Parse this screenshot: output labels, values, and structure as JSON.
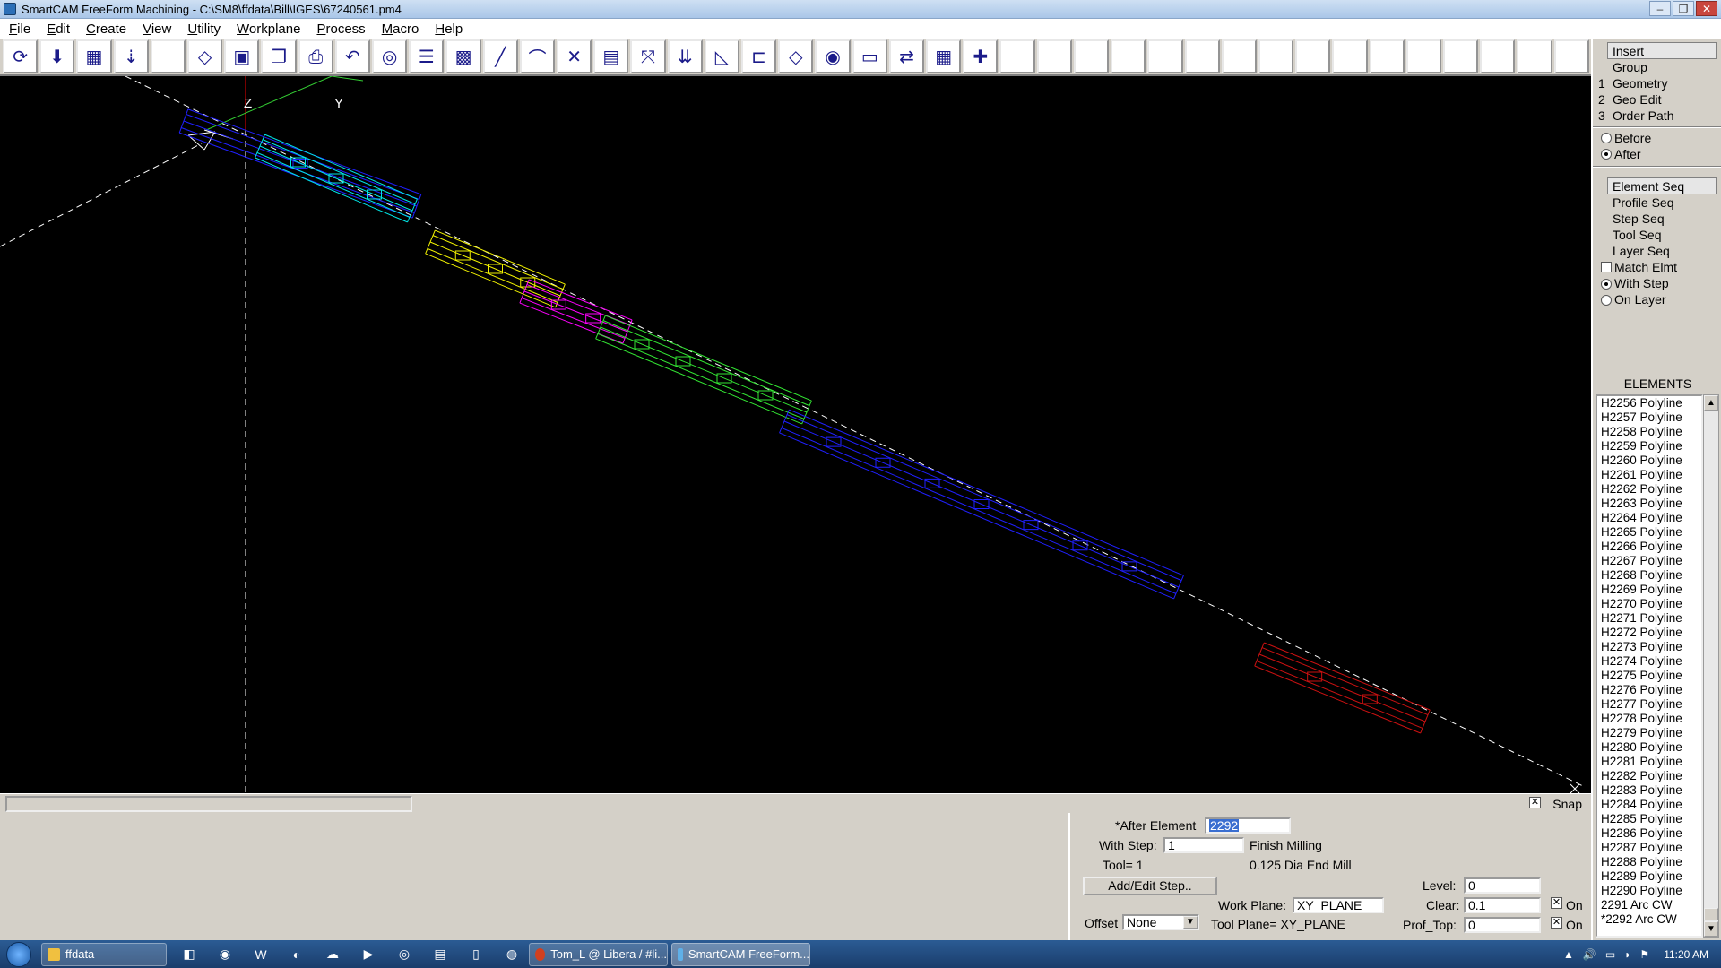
{
  "window": {
    "title": "SmartCAM FreeForm Machining - C:\\SM8\\ffdata\\Bill\\IGES\\67240561.pm4",
    "controls": [
      "–",
      "❐",
      "✕"
    ]
  },
  "menu": [
    "File",
    "Edit",
    "Create",
    "View",
    "Utility",
    "Workplane",
    "Process",
    "Macro",
    "Help"
  ],
  "toolbar": {
    "buttons": [
      {
        "name": "regen-icon",
        "glyph": "⟳"
      },
      {
        "name": "save-icon",
        "glyph": "⬇"
      },
      {
        "name": "fill-icon",
        "glyph": "▦"
      },
      {
        "name": "tool-point-icon",
        "glyph": "⇣"
      },
      {
        "name": "blank-icon",
        "glyph": ""
      },
      {
        "name": "plane-icon",
        "glyph": "◇"
      },
      {
        "name": "machine-icon",
        "glyph": "▣"
      },
      {
        "name": "copy-icon",
        "glyph": "❐"
      },
      {
        "name": "print-icon",
        "glyph": "⎙"
      },
      {
        "name": "undo-icon",
        "glyph": "↶"
      },
      {
        "name": "rotate-view-icon",
        "glyph": "◎"
      },
      {
        "name": "layer-stack-icon",
        "glyph": "☰"
      },
      {
        "name": "surface-icon",
        "glyph": "▩"
      },
      {
        "name": "line-icon",
        "glyph": "╱"
      },
      {
        "name": "arc-icon",
        "glyph": "⌒"
      },
      {
        "name": "trim-icon",
        "glyph": "✕"
      },
      {
        "name": "calculator-icon",
        "glyph": "▤"
      },
      {
        "name": "transform-icon",
        "glyph": "⤧"
      },
      {
        "name": "offset-icon",
        "glyph": "⇊"
      },
      {
        "name": "fillet-icon",
        "glyph": "◺"
      },
      {
        "name": "profile-icon",
        "glyph": "⊏"
      },
      {
        "name": "measure-icon",
        "glyph": "◇"
      },
      {
        "name": "show-icon",
        "glyph": "◉"
      },
      {
        "name": "ruler-icon",
        "glyph": "▭"
      },
      {
        "name": "swap-icon",
        "glyph": "⇄"
      },
      {
        "name": "calc-icon",
        "glyph": "▦"
      },
      {
        "name": "add-point-icon",
        "glyph": "✚"
      }
    ],
    "empty_count": 16
  },
  "viewport": {
    "axis_z": "Z",
    "axis_y": "Y"
  },
  "status": {
    "snap_label": "Snap",
    "snap_check": "✕"
  },
  "props": {
    "after_element_label": "*After Element",
    "after_element_value": "2292",
    "with_step_label": "With Step:",
    "with_step_value": "1",
    "step_name": "Finish Milling",
    "tool_label": "Tool= 1",
    "tool_desc": "0.125 Dia End Mill",
    "add_edit_step_label": "Add/Edit Step..",
    "offset_label": "Offset",
    "offset_value": "None",
    "work_plane_label": "Work Plane:",
    "work_plane_value": "XY_PLANE",
    "tool_plane_text": "Tool Plane= XY_PLANE",
    "level_label": "Level:",
    "level_value": "0",
    "clear_label": "Clear:",
    "clear_value": "0.1",
    "prof_top_label": "Prof_Top:",
    "prof_top_value": "0",
    "on_label": "On",
    "on_label_2": "On",
    "check_mark": "✕",
    "check_mark_2": "✕"
  },
  "rightpanel": {
    "insert": "Insert",
    "group": "Group",
    "geometry_num": "1",
    "geometry": "Geometry",
    "geoedit_num": "2",
    "geoedit": "Geo Edit",
    "orderpath_num": "3",
    "orderpath": "Order Path",
    "before": "Before",
    "after": "After",
    "element_seq": "Element Seq",
    "profile_seq": "Profile Seq",
    "step_seq": "Step Seq",
    "tool_seq": "Tool Seq",
    "layer_seq": "Layer Seq",
    "match_elmt": "Match Elmt",
    "with_step": "With Step",
    "on_layer": "On Layer",
    "elements_title": "ELEMENTS",
    "elements": [
      "H2256 Polyline",
      "H2257 Polyline",
      "H2258 Polyline",
      "H2259 Polyline",
      "H2260 Polyline",
      "H2261 Polyline",
      "H2262 Polyline",
      "H2263 Polyline",
      "H2264 Polyline",
      "H2265 Polyline",
      "H2266 Polyline",
      "H2267 Polyline",
      "H2268 Polyline",
      "H2269 Polyline",
      "H2270 Polyline",
      "H2271 Polyline",
      "H2272 Polyline",
      "H2273 Polyline",
      "H2274 Polyline",
      "H2275 Polyline",
      "H2276 Polyline",
      "H2277 Polyline",
      "H2278 Polyline",
      "H2279 Polyline",
      "H2280 Polyline",
      "H2281 Polyline",
      "H2282 Polyline",
      "H2283 Polyline",
      "H2284 Polyline",
      "H2285 Polyline",
      "H2286 Polyline",
      "H2287 Polyline",
      "H2288 Polyline",
      "H2289 Polyline",
      "H2290 Polyline",
      " 2291 Arc  CW",
      "*2292 Arc  CW"
    ]
  },
  "taskbar": {
    "folder_task": "ffdata",
    "irc_task": "Tom_L @ Libera / #li...",
    "smartcam_task": "SmartCAM FreeForm...",
    "quick": [
      "◧",
      "◉",
      "W",
      "◐",
      "☁",
      "▶",
      "◎",
      "▤",
      "▯",
      "◍"
    ],
    "clock": "11:20 AM",
    "tray_icons": [
      "▲",
      "🔊",
      "▭",
      "◗",
      "⚑"
    ]
  },
  "colors": {
    "cyan": "#00e5e5",
    "yellow": "#f2f200",
    "magenta": "#ff00ff",
    "green": "#33e633",
    "blue": "#2020ff",
    "red": "#cc1111"
  }
}
